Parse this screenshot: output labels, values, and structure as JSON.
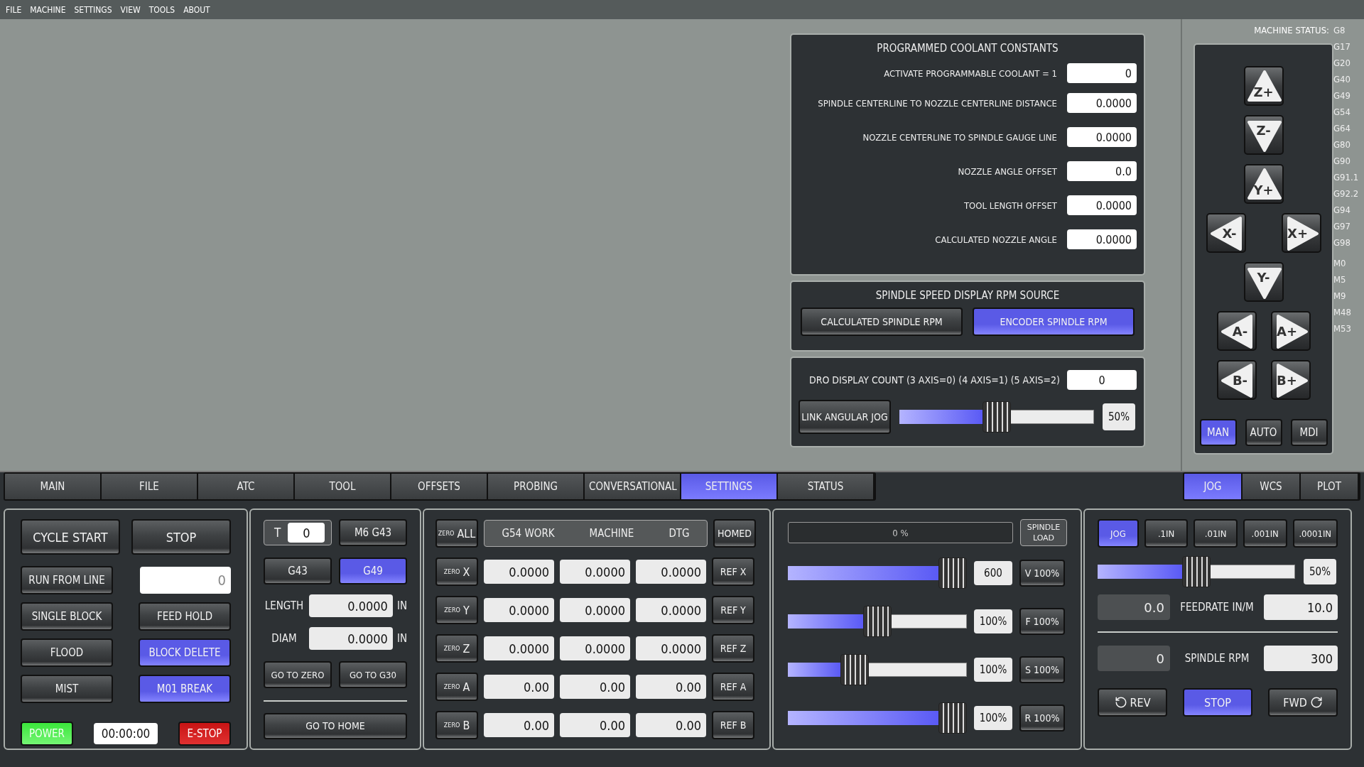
{
  "menu": [
    "FILE",
    "MACHINE",
    "SETTINGS",
    "VIEW",
    "TOOLS",
    "ABOUT"
  ],
  "coolant": {
    "title": "PROGRAMMED COOLANT CONSTANTS",
    "rows": [
      {
        "label": "ACTIVATE PROGRAMMABLE COOLANT = 1",
        "value": "0"
      },
      {
        "label": "SPINDLE CENTERLINE TO NOZZLE CENTERLINE DISTANCE",
        "value": "0.0000"
      },
      {
        "label": "NOZZLE CENTERLINE TO SPINDLE GAUGE LINE",
        "value": "0.0000"
      },
      {
        "label": "NOZZLE ANGLE OFFSET",
        "value": "0.0"
      },
      {
        "label": "TOOL LENGTH OFFSET",
        "value": "0.0000"
      },
      {
        "label": "CALCULATED NOZZLE ANGLE",
        "value": "0.0000"
      }
    ]
  },
  "rpm_source": {
    "title": "SPINDLE SPEED DISPLAY RPM SOURCE",
    "options": [
      {
        "label": "CALCULATED SPINDLE RPM",
        "selected": false
      },
      {
        "label": "ENCODER SPINDLE RPM",
        "selected": true
      }
    ]
  },
  "dro_count": {
    "label": "DRO DISPLAY COUNT (3 AXIS=0) (4 AXIS=1) (5 AXIS=2)",
    "value": "0",
    "link_button": "LINK ANGULAR JOG",
    "level": 0.5,
    "reading": "50%"
  },
  "machine_status": {
    "label": "MACHINE STATUS:",
    "g_codes": [
      "G8",
      "G17",
      "G20",
      "G40",
      "G49",
      "G54",
      "G64",
      "G80",
      "G90",
      "G91.1",
      "G92.2",
      "G94",
      "G97",
      "G98"
    ],
    "m_codes": [
      "M0",
      "M5",
      "M9",
      "M48",
      "M53"
    ]
  },
  "jog_pad": {
    "rows": [
      [
        {
          "label": "Z+",
          "kind": "up"
        }
      ],
      [
        {
          "label": "Z-",
          "kind": "down"
        }
      ],
      [
        {
          "label": "Y+",
          "kind": "up"
        }
      ],
      [
        {
          "label": "X-",
          "kind": "left"
        },
        {
          "label": "X+",
          "kind": "right"
        }
      ],
      [
        {
          "label": "Y-",
          "kind": "down"
        }
      ],
      [
        {
          "label": "A-",
          "kind": "left"
        },
        {
          "label": "A+",
          "kind": "right"
        }
      ],
      [
        {
          "label": "B-",
          "kind": "left"
        },
        {
          "label": "B+",
          "kind": "right"
        }
      ]
    ],
    "modes": [
      {
        "label": "MAN",
        "selected": true
      },
      {
        "label": "AUTO",
        "selected": false
      },
      {
        "label": "MDI",
        "selected": false
      }
    ]
  },
  "tabs": [
    {
      "label": "MAIN",
      "selected": false
    },
    {
      "label": "FILE",
      "selected": false
    },
    {
      "label": "ATC",
      "selected": false
    },
    {
      "label": "TOOL",
      "selected": false
    },
    {
      "label": "OFFSETS",
      "selected": false
    },
    {
      "label": "PROBING",
      "selected": false
    },
    {
      "label": "CONVERSATIONAL",
      "selected": false
    },
    {
      "label": "SETTINGS",
      "selected": true
    },
    {
      "label": "STATUS",
      "selected": false
    }
  ],
  "view_tabs": [
    {
      "label": "JOG",
      "selected": true
    },
    {
      "label": "WCS",
      "selected": false
    },
    {
      "label": "PLOT",
      "selected": false
    }
  ],
  "run_panel": {
    "cycle_start": "CYCLE START",
    "stop": "STOP",
    "run_from_line": "RUN FROM LINE",
    "line": "0",
    "toggles": [
      {
        "label": "SINGLE BLOCK",
        "on": false
      },
      {
        "label": "FEED HOLD",
        "on": false
      },
      {
        "label": "FLOOD",
        "on": false
      },
      {
        "label": "BLOCK DELETE",
        "on": true
      },
      {
        "label": "MIST",
        "on": false
      },
      {
        "label": "M01 BREAK",
        "on": true
      }
    ],
    "power": "POWER",
    "timer": "00:00:00",
    "estop": "E-STOP"
  },
  "tool_panel": {
    "t_label": "T",
    "tool": "0",
    "m6": "M6 G43",
    "offsets": [
      {
        "label": "G43",
        "selected": false
      },
      {
        "label": "G49",
        "selected": true
      }
    ],
    "fields": [
      {
        "label": "LENGTH",
        "value": "0.0000",
        "unit": "IN"
      },
      {
        "label": "DIAM",
        "value": "0.0000",
        "unit": "IN"
      }
    ],
    "buttons": [
      "GO TO ZERO",
      "GO TO G30"
    ],
    "home": "GO TO HOME"
  },
  "dro": {
    "zero_all": {
      "prefix": "ZERO",
      "axis": "ALL"
    },
    "columns": [
      "G54 WORK",
      "MACHINE",
      "DTG"
    ],
    "homed": "HOMED",
    "axes": [
      {
        "prefix": "ZERO",
        "axis": "X",
        "values": [
          "0.0000",
          "0.0000",
          "0.0000"
        ],
        "ref": "REF X"
      },
      {
        "prefix": "ZERO",
        "axis": "Y",
        "values": [
          "0.0000",
          "0.0000",
          "0.0000"
        ],
        "ref": "REF Y"
      },
      {
        "prefix": "ZERO",
        "axis": "Z",
        "values": [
          "0.0000",
          "0.0000",
          "0.0000"
        ],
        "ref": "REF Z"
      },
      {
        "prefix": "ZERO",
        "axis": "A",
        "values": [
          "0.00",
          "0.00",
          "0.00"
        ],
        "ref": "REF A"
      },
      {
        "prefix": "ZERO",
        "axis": "B",
        "values": [
          "0.00",
          "0.00",
          "0.00"
        ],
        "ref": "REF B"
      }
    ]
  },
  "overrides": {
    "spindle_load": {
      "reading": "0 %",
      "label": "SPINDLE LOAD"
    },
    "rows": [
      {
        "level": 1,
        "reading": "600",
        "button": "V 100%"
      },
      {
        "level": 0.5,
        "reading": "100%",
        "button": "F 100%"
      },
      {
        "level": 0.35,
        "reading": "100%",
        "button": "S 100%"
      },
      {
        "level": 1,
        "reading": "100%",
        "button": "R 100%"
      }
    ]
  },
  "spindle_panel": {
    "steps": [
      {
        "label": "JOG",
        "selected": true
      },
      {
        "label": ".1IN",
        "selected": false
      },
      {
        "label": ".01IN",
        "selected": false
      },
      {
        "label": ".001IN",
        "selected": false
      },
      {
        "label": ".0001IN",
        "selected": false
      }
    ],
    "jog_slider": {
      "level": 0.5
    },
    "jog_reading": "50%",
    "feed": {
      "current": "0.0",
      "label": "FEEDRATE IN/M",
      "value": "10.0"
    },
    "spindle": {
      "current": "0",
      "label": "SPINDLE RPM",
      "value": "300"
    },
    "controls": [
      {
        "label": "REV",
        "kind": "ccw",
        "selected": false
      },
      {
        "label": "STOP",
        "kind": "stop",
        "selected": true
      },
      {
        "label": "FWD",
        "kind": "cw",
        "selected": false
      }
    ]
  }
}
